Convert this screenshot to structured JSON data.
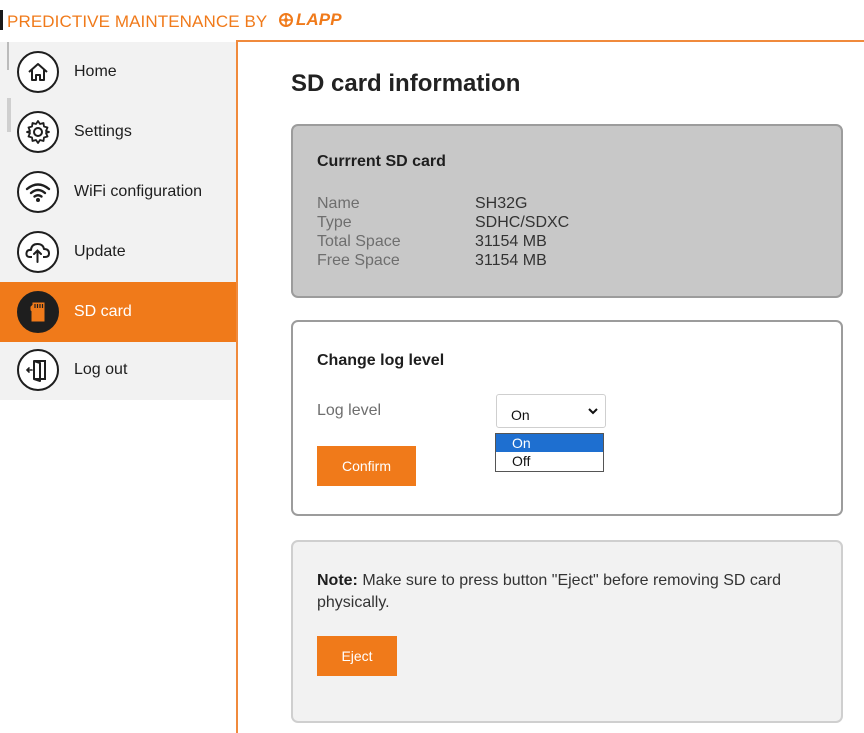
{
  "header": {
    "brand": "PREDICTIVE MAINTENANCE BY",
    "logo_text": "LAPP"
  },
  "sidebar": {
    "items": [
      {
        "label": "Home",
        "icon": "home-icon"
      },
      {
        "label": "Settings",
        "icon": "gear-icon"
      },
      {
        "label": "WiFi configuration",
        "icon": "wifi-icon"
      },
      {
        "label": "Update",
        "icon": "cloud-upload-icon"
      },
      {
        "label": "SD card",
        "icon": "sd-card-icon",
        "active": true
      },
      {
        "label": "Log out",
        "icon": "logout-door-icon"
      }
    ]
  },
  "main": {
    "title": "SD card information",
    "sd_card": {
      "title": "Currrent SD card",
      "rows": [
        {
          "key": "Name",
          "value": "SH32G"
        },
        {
          "key": "Type",
          "value": "SDHC/SDXC"
        },
        {
          "key": "Total Space",
          "value": "31154 MB"
        },
        {
          "key": "Free Space",
          "value": "31154 MB"
        }
      ]
    },
    "log_level": {
      "title": "Change log level",
      "label": "Log level",
      "selected": "On",
      "options": [
        "On",
        "Off"
      ],
      "confirm_label": "Confirm"
    },
    "note": {
      "bold": "Note:",
      "text": " Make sure to press button \"Eject\" before removing SD card physically.",
      "eject_label": "Eject"
    }
  },
  "colors": {
    "accent": "#f07a1a",
    "sidebar_bg": "#f2f2f2",
    "card_gray": "#c8c8c8",
    "option_highlight": "#1e6fd0"
  }
}
